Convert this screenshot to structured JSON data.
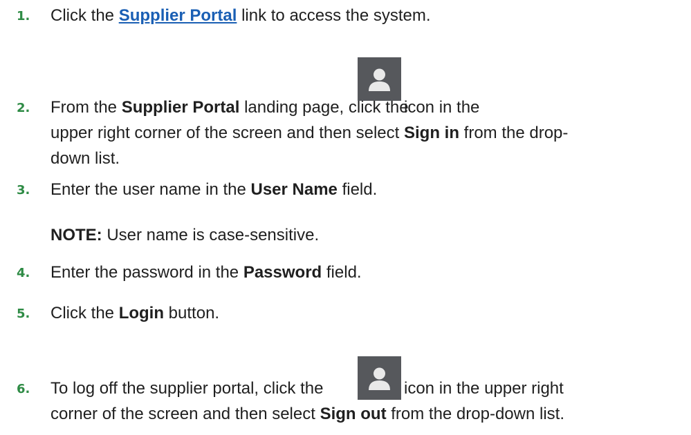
{
  "steps": [
    {
      "number": "1.",
      "pre": "Click the ",
      "link": "Supplier Portal",
      "post": " link to access the system."
    },
    {
      "number": "2.",
      "line1_pre": "From the ",
      "line1_bold": "Supplier Portal",
      "line1_mid": " landing page, click the ",
      "line1_post": " icon in the",
      "line2_pre": "upper right corner of the screen and then select ",
      "line2_bold": "Sign in",
      "line2_post": " from the drop-",
      "line3": "down list."
    },
    {
      "number": "3.",
      "pre": "Enter the user name in the ",
      "bold": "User Name",
      "post": " field."
    },
    {
      "note_label": "NOTE:",
      "note_text": " User name is case-sensitive."
    },
    {
      "number": "4.",
      "pre": "Enter the password in the ",
      "bold": "Password",
      "post": " field."
    },
    {
      "number": "5.",
      "pre": "Click the ",
      "bold": "Login",
      "post": " button."
    },
    {
      "number": "6.",
      "line1_pre": "To log off the supplier portal, click the ",
      "line1_post": " icon in the upper right",
      "line2_pre": "corner of the screen and then select ",
      "line2_bold": "Sign out",
      "line2_post": " from the drop-down list."
    }
  ],
  "icons": {
    "user": "user-profile-icon"
  },
  "colors": {
    "number": "#2e8b45",
    "link": "#1a5fb4",
    "icon_bg": "#56585c"
  }
}
